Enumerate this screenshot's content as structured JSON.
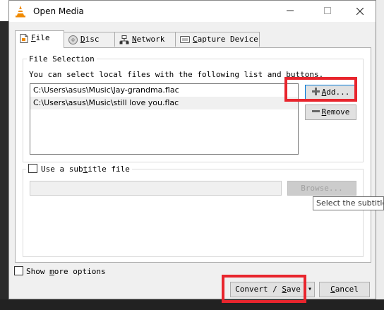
{
  "window": {
    "title": "Open Media"
  },
  "tabs": [
    {
      "pre": "",
      "ul": "F",
      "post": "ile",
      "icon": "file-icon"
    },
    {
      "pre": "",
      "ul": "D",
      "post": "isc",
      "icon": "disc-icon"
    },
    {
      "pre": "",
      "ul": "N",
      "post": "etwork",
      "icon": "network-icon"
    },
    {
      "pre": "",
      "ul": "C",
      "post": "apture Device",
      "icon": "capture-device-icon"
    }
  ],
  "file_selection": {
    "legend": "File Selection",
    "description": "You can select local files with the following list and buttons.",
    "files": [
      "C:\\Users\\asus\\Music\\Jay-grandma.flac",
      "C:\\Users\\asus\\Music\\still love you.flac"
    ],
    "add": {
      "ul": "A",
      "post": "dd..."
    },
    "remove": {
      "ul": "R",
      "post": "emove"
    }
  },
  "subtitle": {
    "pre": "Use a sub",
    "ul": "t",
    "post": "itle file",
    "checked": false,
    "path_value": "",
    "browse_label": "Browse..."
  },
  "tooltip": {
    "text": "Select the subtitle file"
  },
  "footer": {
    "show_more": {
      "pre": "Show ",
      "ul": "m",
      "post": "ore options",
      "checked": false
    },
    "convert": {
      "pre": "Convert / ",
      "ul": "S",
      "post": "ave"
    },
    "dropdown_arrow": "▾",
    "cancel": {
      "ul": "C",
      "post": "ancel"
    }
  },
  "colors": {
    "highlight": "#e8252d",
    "accent": "#0078d7",
    "vlc_orange": "#f08a00"
  }
}
